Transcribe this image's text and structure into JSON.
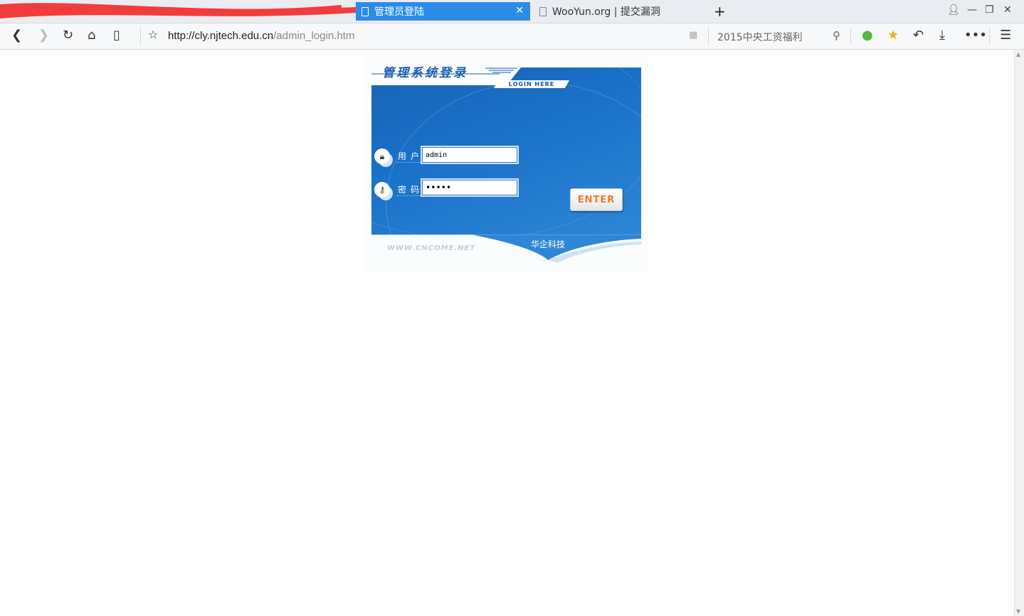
{
  "browser": {
    "tabs": [
      {
        "title": "管理员登陆",
        "active": true
      },
      {
        "title": "WooYun.org | 提交漏洞",
        "active": false
      }
    ],
    "new_tab": "+",
    "url": {
      "host": "http://cly.njtech.edu.cn",
      "path": "/admin_login.htm"
    },
    "search_text": "2015中央工资福利"
  },
  "login": {
    "title": "管理系统登录",
    "badge": "LOGIN HERE",
    "user_label": "用户",
    "user_value": "admin",
    "pass_label": "密码",
    "pass_value": "•••••",
    "enter_label": "ENTER",
    "site": "WWW.CNCOME.NET",
    "company": "华企科技"
  },
  "colors": {
    "tab_active": "#2b8ce8",
    "panel_blue": "#1a72c9",
    "enter_text": "#f07a23"
  }
}
